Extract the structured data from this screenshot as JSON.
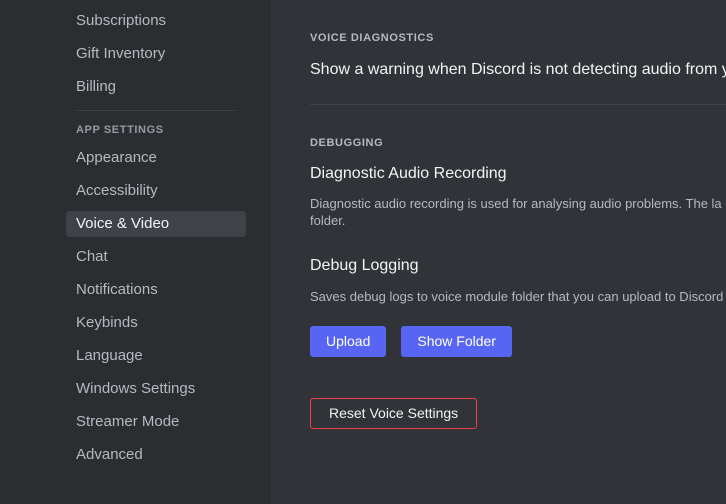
{
  "theme": {
    "sidebar_bg": "#2b2d31",
    "content_bg": "#313338",
    "selected_bg": "#3f4248",
    "divider": "#3f4147",
    "text_primary": "#f2f3f5",
    "text_muted": "#b5bac1",
    "accent_blurple": "#5865f2",
    "accent_danger": "#ed4245"
  },
  "sidebar": {
    "items_top": [
      {
        "label": "Subscriptions",
        "selected": false
      },
      {
        "label": "Gift Inventory",
        "selected": false
      },
      {
        "label": "Billing",
        "selected": false
      }
    ],
    "group_header": "APP SETTINGS",
    "items_app": [
      {
        "label": "Appearance",
        "selected": false
      },
      {
        "label": "Accessibility",
        "selected": false
      },
      {
        "label": "Voice & Video",
        "selected": true
      },
      {
        "label": "Chat",
        "selected": false
      },
      {
        "label": "Notifications",
        "selected": false
      },
      {
        "label": "Keybinds",
        "selected": false
      },
      {
        "label": "Language",
        "selected": false
      },
      {
        "label": "Windows Settings",
        "selected": false
      },
      {
        "label": "Streamer Mode",
        "selected": false
      },
      {
        "label": "Advanced",
        "selected": false
      }
    ]
  },
  "main": {
    "voice_diagnostics": {
      "section_header": "VOICE DIAGNOSTICS",
      "warning_label": "Show a warning when Discord is not detecting audio from you"
    },
    "debugging": {
      "section_header": "DEBUGGING",
      "diagnostic_recording": {
        "title": "Diagnostic Audio Recording",
        "description": "Diagnostic audio recording is used for analysing audio problems. The la module folder."
      },
      "debug_logging": {
        "title": "Debug Logging",
        "description": "Saves debug logs to voice module folder that you can upload to Discord",
        "upload_label": "Upload",
        "show_folder_label": "Show Folder"
      },
      "reset_label": "Reset Voice Settings"
    }
  }
}
